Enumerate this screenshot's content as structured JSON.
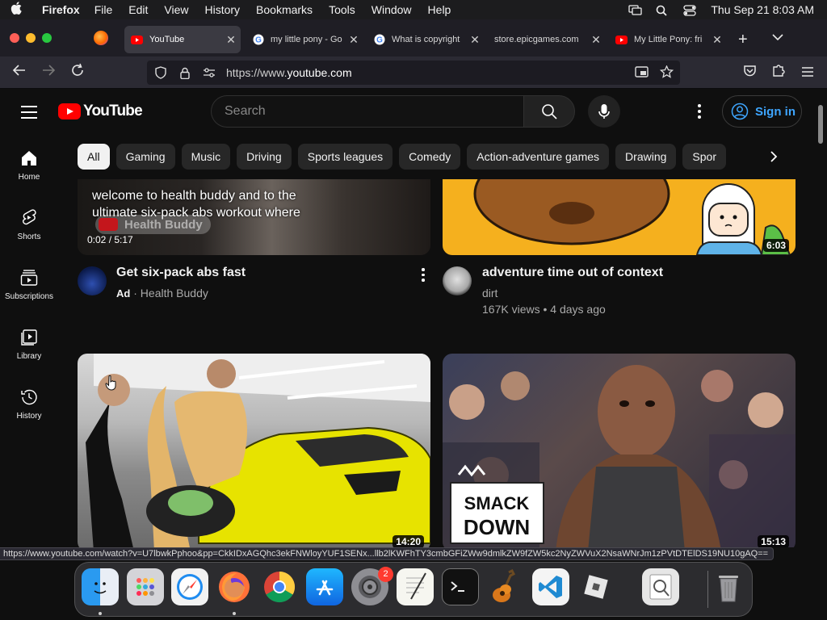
{
  "menubar": {
    "app_name": "Firefox",
    "items": [
      "File",
      "Edit",
      "View",
      "History",
      "Bookmarks",
      "Tools",
      "Window",
      "Help"
    ],
    "datetime": "Thu Sep 21  8:03 AM"
  },
  "tabs": [
    {
      "title": "YouTube",
      "active": true
    },
    {
      "title": "my little pony - Go",
      "active": false
    },
    {
      "title": "What is copyright",
      "active": false
    },
    {
      "title": "store.epicgames.com",
      "active": false
    },
    {
      "title": "My Little Pony: fri",
      "active": false
    }
  ],
  "navbar": {
    "url_scheme": "https://www.",
    "url_host": "youtube.com"
  },
  "youtube": {
    "logo_text": "YouTube",
    "search_placeholder": "Search",
    "signin_label": "Sign in",
    "guide": [
      {
        "label": "Home",
        "icon": "home-icon"
      },
      {
        "label": "Shorts",
        "icon": "shorts-icon"
      },
      {
        "label": "Subscriptions",
        "icon": "subscriptions-icon"
      },
      {
        "label": "Library",
        "icon": "library-icon"
      },
      {
        "label": "History",
        "icon": "history-icon"
      }
    ],
    "chips": [
      "All",
      "Gaming",
      "Music",
      "Driving",
      "Sports leagues",
      "Comedy",
      "Action-adventure games",
      "Drawing",
      "Spor"
    ],
    "videos": [
      {
        "title": "Get six-pack abs fast",
        "overlay_caption": "welcome to health buddy and to the ultimate six-pack abs workout where",
        "overlay_channel": "Health Buddy",
        "timecode": "0:02 / 5:17",
        "ad_label": "Ad",
        "channel": "Health Buddy"
      },
      {
        "title": "adventure time out of context",
        "channel": "dirt",
        "stats": "167K views • 4 days ago",
        "duration": "6:03"
      },
      {
        "duration": "14:20"
      },
      {
        "duration": "15:13",
        "thumb_text_1": "SMACK",
        "thumb_text_2": "DOWN"
      }
    ]
  },
  "status_url": "https://www.youtube.com/watch?v=U7lbwkPphoo&pp=CkkIDxAGQhc3ekFNWloyYUF1SENx...llb2lKWFhTY3cmbGFiZWw9dmlkZW9fZW5kc2NyZWVuX2NsaWNrJm1zPVtDTElDS19NU10gAQ==",
  "dock": {
    "apps": [
      "finder-icon",
      "launchpad-icon",
      "safari-icon",
      "firefox-icon",
      "chrome-icon",
      "app-store-icon",
      "system-settings-icon",
      "textedit-icon",
      "terminal-icon",
      "garageband-icon",
      "vscode-icon",
      "roblox-icon",
      "preview-icon",
      "trash-icon"
    ],
    "settings_badge": "2"
  },
  "colors": {
    "yt_red": "#ff0000",
    "signin_blue": "#3ea6ff",
    "background": "#0f0f0f"
  }
}
